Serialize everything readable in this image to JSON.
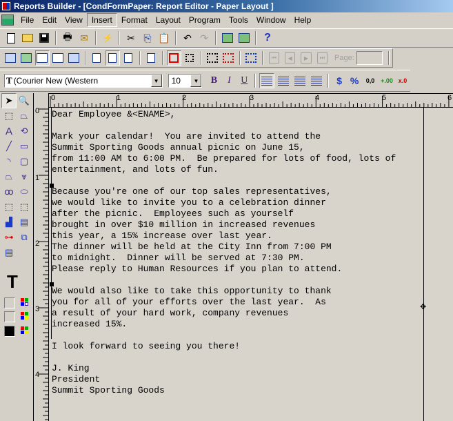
{
  "window": {
    "title": "Reports Builder - [CondFormPaper: Report Editor - Paper Layout ]"
  },
  "menu": {
    "items": [
      "File",
      "Edit",
      "View",
      "Insert",
      "Format",
      "Layout",
      "Program",
      "Tools",
      "Window",
      "Help"
    ],
    "active": "Insert"
  },
  "toolbar_main": {
    "icons": [
      "new-icon",
      "open-icon",
      "save-icon",
      "print-icon",
      "mail-icon",
      "connect-icon",
      "cut-icon",
      "copy-icon",
      "paste-icon",
      "undo-icon",
      "redo-icon",
      "run-web-layout-icon",
      "run-paper-layout-icon",
      "help-icon"
    ]
  },
  "toolbar_views": {
    "icons": [
      "data-model-icon",
      "web-source-icon",
      "paper-layout-icon",
      "paper-design-icon",
      "parameter-form-icon",
      "header-section-icon",
      "main-section-icon",
      "trailer-section-icon",
      "confine-icon",
      "flex-off-icon",
      "flex-on-icon",
      "select-parent-frame-icon",
      "select-all-icon",
      "first-page-icon",
      "previous-page-icon",
      "next-page-icon",
      "last-page-icon"
    ],
    "page_label": "Page:",
    "page_value": ""
  },
  "format_bar": {
    "font": "(Courier New (Western",
    "size": "10",
    "bold": "B",
    "italic": "I",
    "underline": "U",
    "currency": "$",
    "percent": "%",
    "commas": "0,0",
    "add_decimal": "+.00",
    "remove_decimal": "x.0"
  },
  "tool_palette": {
    "tools": [
      "select",
      "magnify",
      "reshape",
      "frame-select",
      "text",
      "rotate",
      "line",
      "rectangle",
      "arc",
      "rounded-rectangle",
      "polygon",
      "polyline",
      "freehand",
      "ellipse",
      "frame",
      "repeating-frame",
      "chart",
      "field",
      "link-file",
      "anchor",
      "query"
    ],
    "text_tool": "T"
  },
  "rulers": {
    "horizontal": [
      "0",
      "1",
      "2",
      "3",
      "4",
      "5",
      "6"
    ],
    "vertical": [
      "0",
      "1",
      "2",
      "3",
      "4"
    ]
  },
  "document": {
    "lines": [
      "Dear Employee &<ENAME>,",
      "",
      "Mark your calendar!  You are invited to attend the",
      "Summit Sporting Goods annual picnic on June 15,",
      "from 11:00 AM to 6:00 PM.  Be prepared for lots of food, lots of",
      "entertainment, and lots of fun.",
      "",
      "Because you're one of our top sales representatives,",
      "we would like to invite you to a celebration dinner",
      "after the picnic.  Employees such as yourself",
      "brought in over $10 million in increased revenues",
      "this year, a 15% increase over last year.",
      "The dinner will be held at the City Inn from 7:00 PM",
      "to midnight.  Dinner will be served at 7:30 PM.",
      "Please reply to Human Resources if you plan to attend.",
      "",
      "We would also like to take this opportunity to thank",
      "you for all of your efforts over the last year.  As",
      "a result of your hard work, company revenues",
      "increased 15%.",
      "",
      "I look forward to seeing you there!",
      "",
      "J. King",
      "President",
      "Summit Sporting Goods"
    ]
  }
}
